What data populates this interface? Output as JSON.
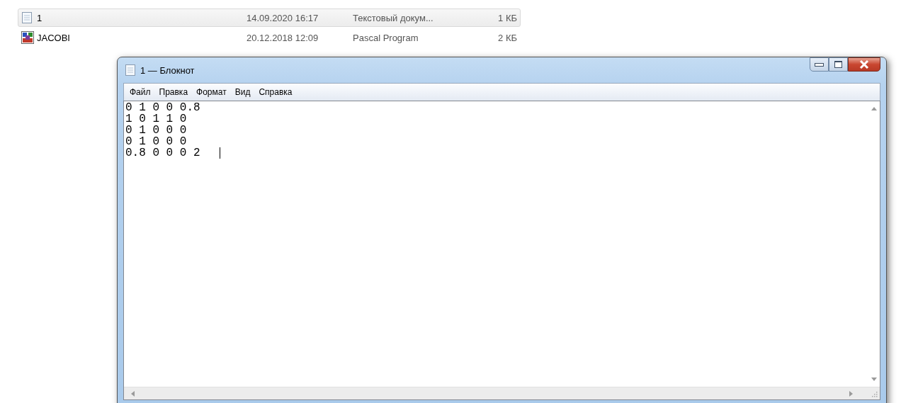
{
  "files": [
    {
      "name": "1",
      "kind": "text",
      "modified": "14.09.2020 16:17",
      "type": "Текстовый докум...",
      "size": "1 КБ",
      "selected": true
    },
    {
      "name": "JACOBI",
      "kind": "pascal",
      "modified": "20.12.2018 12:09",
      "type": "Pascal Program",
      "size": "2 КБ",
      "selected": false
    }
  ],
  "window": {
    "title": "1 — Блокнот",
    "menu": [
      "Файл",
      "Правка",
      "Формат",
      "Вид",
      "Справка"
    ],
    "lines": [
      "0 1 0 0 0.8",
      "1 0 1 1 0",
      "0 1 0 0 0",
      "0 1 0 0 0",
      "0.8 0 0 0 2  "
    ]
  }
}
